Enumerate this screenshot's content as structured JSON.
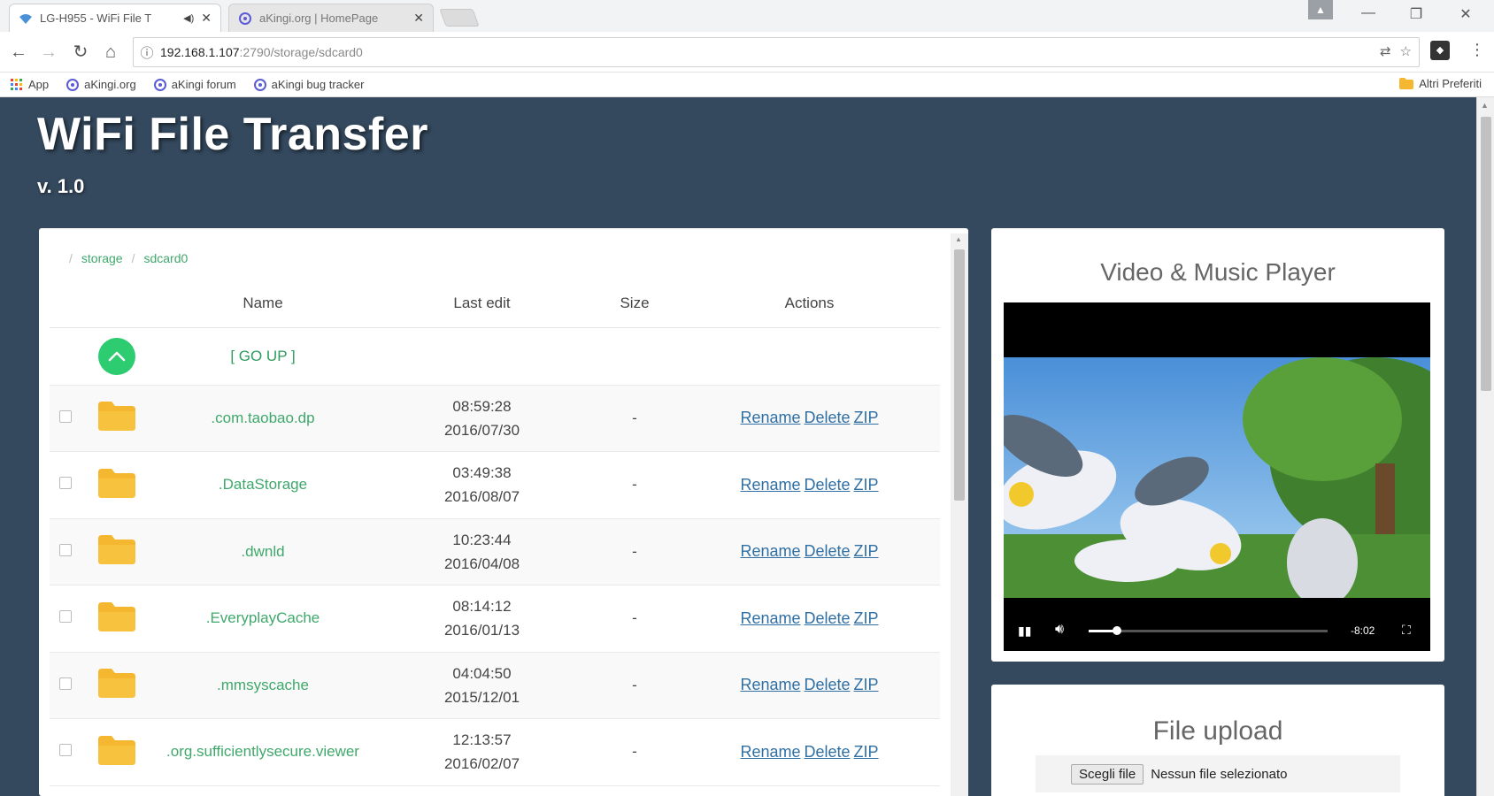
{
  "browser": {
    "tabs": [
      {
        "title": "LG-H955 - WiFi File T"
      },
      {
        "title": "aKingi.org | HomePage"
      }
    ],
    "url_host": "192.168.1.107",
    "url_path": ":2790/storage/sdcard0",
    "bookmarks": [
      {
        "label": "App"
      },
      {
        "label": "aKingi.org"
      },
      {
        "label": "aKingi forum"
      },
      {
        "label": "aKingi bug tracker"
      }
    ],
    "other_bookmarks": "Altri Preferiti"
  },
  "app": {
    "title": "WiFi File Transfer",
    "version": "v. 1.0"
  },
  "breadcrumb": [
    "/",
    "storage",
    "/",
    "sdcard0"
  ],
  "table": {
    "headers": {
      "name": "Name",
      "last_edit": "Last edit",
      "size": "Size",
      "actions": "Actions"
    },
    "go_up": "[ GO UP ]",
    "rows": [
      {
        "name": ".com.taobao.dp",
        "time": "08:59:28",
        "date": "2016/07/30",
        "size": "-"
      },
      {
        "name": ".DataStorage",
        "time": "03:49:38",
        "date": "2016/08/07",
        "size": "-"
      },
      {
        "name": ".dwnld",
        "time": "10:23:44",
        "date": "2016/04/08",
        "size": "-"
      },
      {
        "name": ".EveryplayCache",
        "time": "08:14:12",
        "date": "2016/01/13",
        "size": "-"
      },
      {
        "name": ".mmsyscache",
        "time": "04:04:50",
        "date": "2015/12/01",
        "size": "-"
      },
      {
        "name": ".org.sufficientlysecure.viewer",
        "time": "12:13:57",
        "date": "2016/02/07",
        "size": "-"
      }
    ],
    "actions": {
      "rename": "Rename",
      "delete": "Delete",
      "zip": "ZIP"
    }
  },
  "player": {
    "title": "Video & Music Player",
    "time_remaining": "-8:02",
    "progress": 0.12
  },
  "upload": {
    "title": "File upload",
    "choose_label": "Scegli file",
    "no_file": "Nessun file selezionato"
  },
  "colors": {
    "page_bg": "#34495e",
    "accent_green": "#2ecc71",
    "link_green": "#3fa86b",
    "link_blue": "#2f6fa3",
    "folder": "#f5b72f"
  }
}
